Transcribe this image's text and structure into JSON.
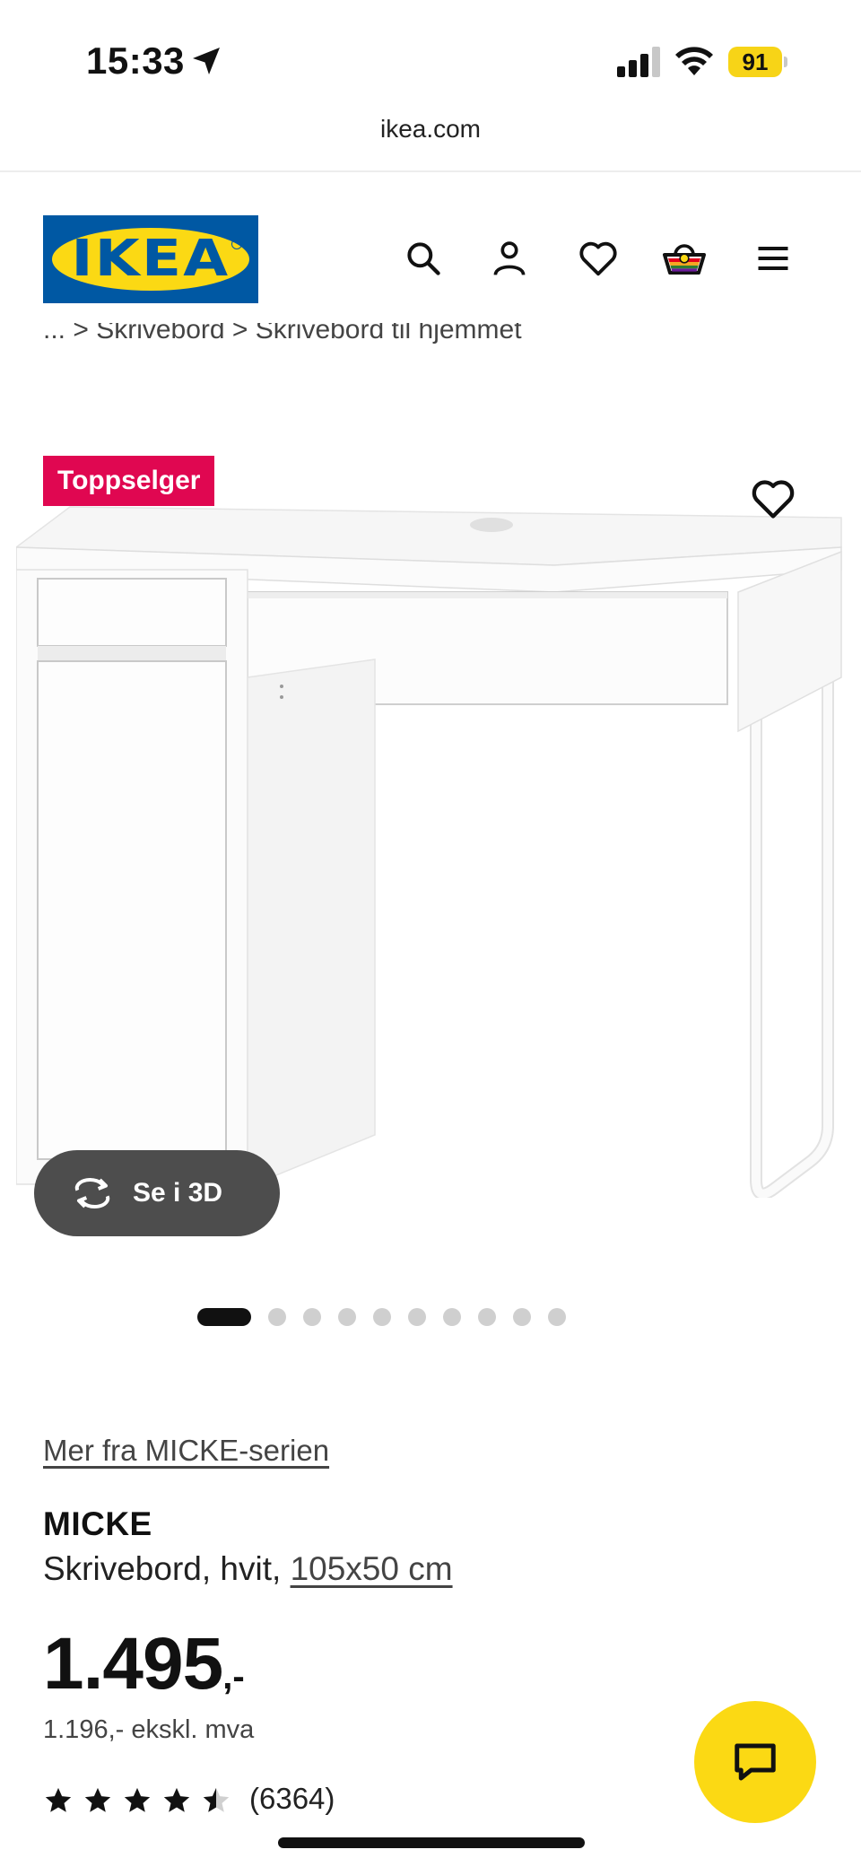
{
  "status_bar": {
    "time": "15:33",
    "battery": "91"
  },
  "browser": {
    "url": "ikea.com"
  },
  "header": {
    "logo_text": "IKEA",
    "icons": [
      "search-icon",
      "account-icon",
      "favourites-icon",
      "shopping-bag-icon",
      "menu-icon"
    ]
  },
  "breadcrumb": {
    "text": "... > Skrivebord > Skrivebord til hjemmet"
  },
  "product_media": {
    "badge": "Toppselger",
    "view_3d_label": "Se i 3D",
    "image_count": 10,
    "active_image_index": 0
  },
  "product": {
    "series_link": "Mer fra MICKE-serien",
    "name": "MICKE",
    "description": "Skrivebord, hvit, ",
    "dimensions": "105x50 cm",
    "price_main": "1.495",
    "price_suffix": ",-",
    "price_ex_vat": "1.196,- ekskl. mva",
    "rating": 4.5,
    "review_count": "(6364)"
  },
  "colors": {
    "ikea_blue": "#0058a3",
    "ikea_yellow": "#fbd914",
    "badge_red": "#e00751",
    "button_dark": "#4d4d4d"
  }
}
